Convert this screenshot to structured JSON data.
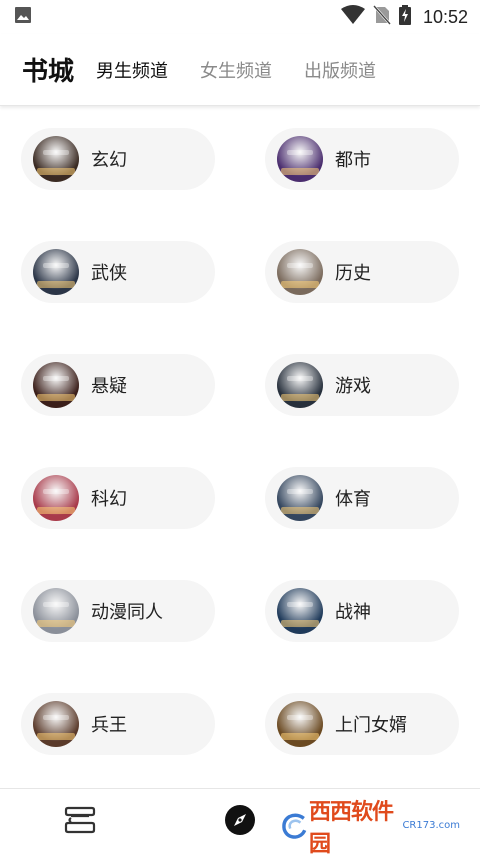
{
  "status_bar": {
    "time": "10:52",
    "icons": [
      "image-notification-icon",
      "wifi-icon",
      "no-sim-icon",
      "battery-charging-icon"
    ]
  },
  "header": {
    "title": "书城",
    "tabs": [
      {
        "label": "男生频道",
        "active": true
      },
      {
        "label": "女生频道",
        "active": false
      },
      {
        "label": "出版频道",
        "active": false
      }
    ]
  },
  "categories": [
    {
      "label": "玄幻",
      "cover_color": "#3a2a22"
    },
    {
      "label": "都市",
      "cover_color": "#4a2d6e"
    },
    {
      "label": "武侠",
      "cover_color": "#2b3547"
    },
    {
      "label": "历史",
      "cover_color": "#7a6a5c"
    },
    {
      "label": "悬疑",
      "cover_color": "#3b1f1a"
    },
    {
      "label": "游戏",
      "cover_color": "#27303c"
    },
    {
      "label": "科幻",
      "cover_color": "#a83a4a"
    },
    {
      "label": "体育",
      "cover_color": "#34465e"
    },
    {
      "label": "动漫同人",
      "cover_color": "#8a8f99"
    },
    {
      "label": "战神",
      "cover_color": "#1f3a5a"
    },
    {
      "label": "兵王",
      "cover_color": "#5a3a2a"
    },
    {
      "label": "上门女婿",
      "cover_color": "#6b4a22"
    }
  ],
  "bottom_nav": {
    "items": [
      {
        "icon": "bookshelf-icon",
        "active": false
      },
      {
        "icon": "compass-icon",
        "active": true
      }
    ]
  },
  "watermark": {
    "main": "西西软件园",
    "sub": "CR173.com"
  }
}
